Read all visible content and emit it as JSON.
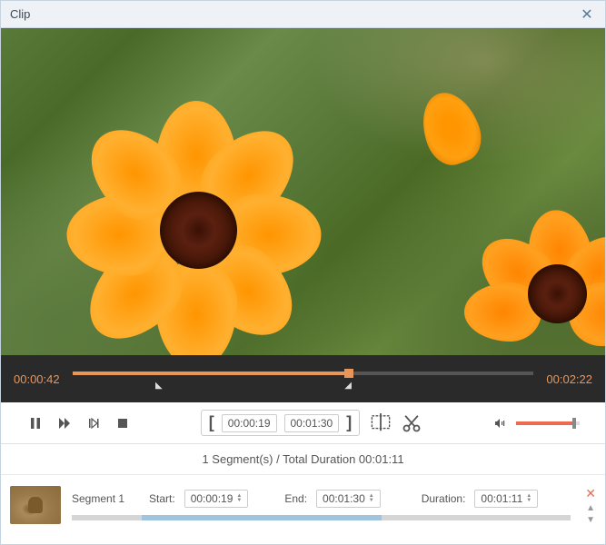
{
  "title": "Clip",
  "playback": {
    "current_time": "00:00:42",
    "total_time": "00:02:22"
  },
  "trim": {
    "in_time": "00:00:19",
    "out_time": "00:01:30"
  },
  "segments_summary": "1 Segment(s) / Total Duration 00:01:11",
  "segments": [
    {
      "name": "Segment 1",
      "start_label": "Start:",
      "start": "00:00:19",
      "end_label": "End:",
      "end": "00:01:30",
      "duration_label": "Duration:",
      "duration": "00:01:11"
    }
  ]
}
